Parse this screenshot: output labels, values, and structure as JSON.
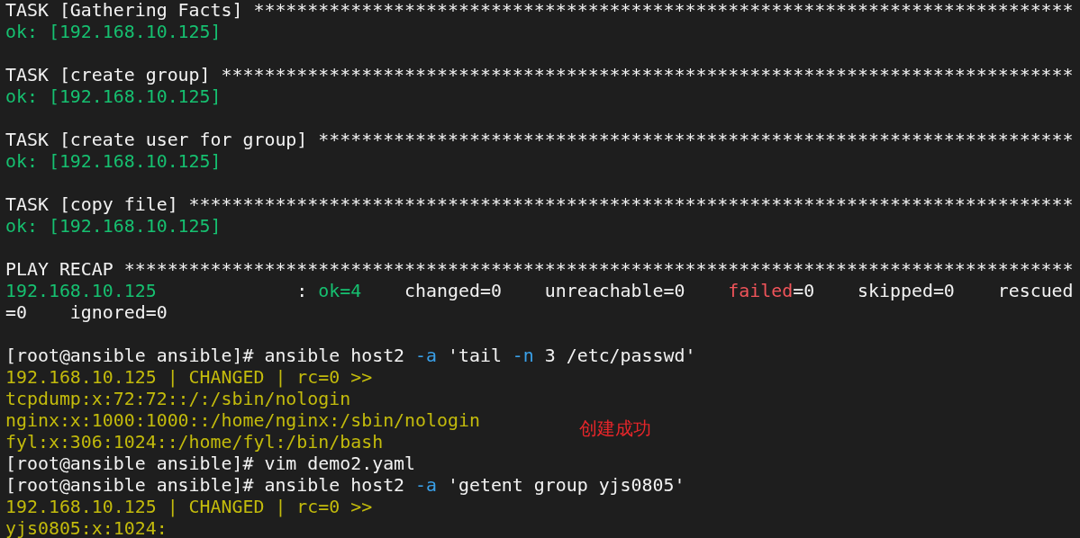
{
  "terminal": {
    "lines": [
      {
        "kind": "text",
        "segments": [
          {
            "kind": "plain",
            "text": "TASK [Gathering Facts] ****************************************************************************"
          }
        ]
      },
      {
        "kind": "text",
        "segments": [
          {
            "kind": "ok",
            "text": "ok: [192.168.10.125]"
          }
        ]
      },
      {
        "kind": "blank"
      },
      {
        "kind": "text",
        "segments": [
          {
            "kind": "plain",
            "text": "TASK [create group] *******************************************************************************"
          }
        ]
      },
      {
        "kind": "text",
        "segments": [
          {
            "kind": "ok",
            "text": "ok: [192.168.10.125]"
          }
        ]
      },
      {
        "kind": "blank"
      },
      {
        "kind": "text",
        "segments": [
          {
            "kind": "plain",
            "text": "TASK [create user for group] **********************************************************************"
          }
        ]
      },
      {
        "kind": "text",
        "segments": [
          {
            "kind": "ok",
            "text": "ok: [192.168.10.125]"
          }
        ]
      },
      {
        "kind": "blank"
      },
      {
        "kind": "text",
        "segments": [
          {
            "kind": "plain",
            "text": "TASK [copy file] **********************************************************************************"
          }
        ]
      },
      {
        "kind": "text",
        "segments": [
          {
            "kind": "ok",
            "text": "ok: [192.168.10.125]"
          }
        ]
      },
      {
        "kind": "blank"
      },
      {
        "kind": "text",
        "segments": [
          {
            "kind": "plain",
            "text": "PLAY RECAP ****************************************************************************************"
          }
        ]
      },
      {
        "kind": "text",
        "segments": [
          {
            "kind": "ok",
            "text": "192.168.10.125"
          },
          {
            "kind": "plain",
            "text": "             : "
          },
          {
            "kind": "ok",
            "text": "ok=4"
          },
          {
            "kind": "plain",
            "text": "    changed=0    unreachable=0    "
          },
          {
            "kind": "failed",
            "text": "failed"
          },
          {
            "kind": "plain",
            "text": "=0    skipped=0    rescued"
          }
        ]
      },
      {
        "kind": "text",
        "segments": [
          {
            "kind": "plain",
            "text": "=0    ignored=0"
          }
        ]
      },
      {
        "kind": "blank"
      },
      {
        "kind": "text",
        "segments": [
          {
            "kind": "plain",
            "text": "[root@ansible ansible]# ansible host2 "
          },
          {
            "kind": "flag",
            "text": "-a"
          },
          {
            "kind": "plain",
            "text": " 'tail "
          },
          {
            "kind": "flag",
            "text": "-n"
          },
          {
            "kind": "plain",
            "text": " 3 /etc/passwd'"
          }
        ]
      },
      {
        "kind": "text",
        "segments": [
          {
            "kind": "changed",
            "text": "192.168.10.125 | CHANGED | rc=0 >>"
          }
        ]
      },
      {
        "kind": "text",
        "segments": [
          {
            "kind": "changed",
            "text": "tcpdump:x:72:72::/:/sbin/nologin"
          }
        ]
      },
      {
        "kind": "text",
        "segments": [
          {
            "kind": "changed",
            "text": "nginx:x:1000:1000::/home/nginx:/sbin/nologin"
          }
        ]
      },
      {
        "kind": "text",
        "segments": [
          {
            "kind": "changed",
            "text": "fyl:x:306:1024::/home/fyl:/bin/bash"
          }
        ]
      },
      {
        "kind": "text",
        "segments": [
          {
            "kind": "plain",
            "text": "[root@ansible ansible]# vim demo2.yaml"
          }
        ]
      },
      {
        "kind": "text",
        "segments": [
          {
            "kind": "plain",
            "text": "[root@ansible ansible]# ansible host2 "
          },
          {
            "kind": "flag",
            "text": "-a"
          },
          {
            "kind": "plain",
            "text": " 'getent group yjs0805'"
          }
        ]
      },
      {
        "kind": "text",
        "segments": [
          {
            "kind": "changed",
            "text": "192.168.10.125 | CHANGED | rc=0 >>"
          }
        ]
      },
      {
        "kind": "text",
        "segments": [
          {
            "kind": "changed",
            "text": "yjs0805:x:1024:"
          }
        ]
      }
    ]
  },
  "annotation": {
    "text": "创建成功"
  }
}
